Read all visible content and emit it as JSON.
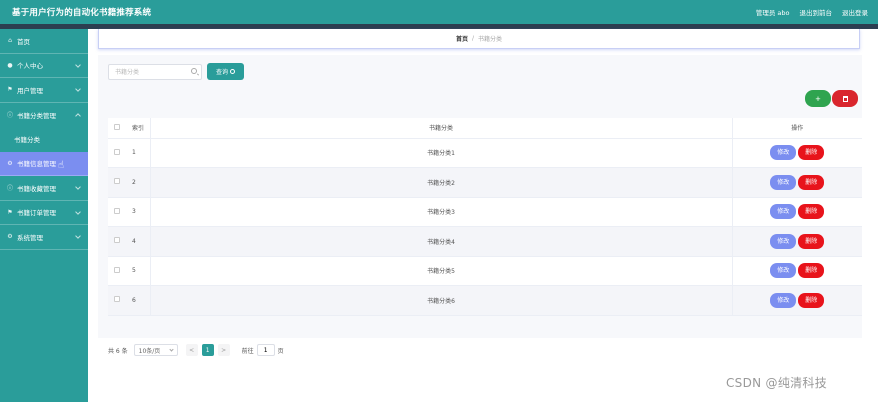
{
  "header": {
    "title": "基于用户行为的自动化书籍推荐系统",
    "welcome": "管理员 abo",
    "exit_backend": "退出到前台",
    "logout": "退出登录"
  },
  "sidebar": {
    "items": [
      {
        "label": "首页",
        "icon": "home-icon"
      },
      {
        "label": "个人中心",
        "icon": "user-icon"
      },
      {
        "label": "用户管理",
        "icon": "flag-icon"
      },
      {
        "label": "书籍分类管理",
        "icon": "info-icon"
      },
      {
        "label": "书籍分类",
        "icon": ""
      },
      {
        "label": "书籍信息管理",
        "icon": "gear-icon"
      },
      {
        "label": "书籍收藏管理",
        "icon": "info-icon"
      },
      {
        "label": "书籍订单管理",
        "icon": "flag-icon"
      },
      {
        "label": "系统管理",
        "icon": "gear-icon"
      }
    ]
  },
  "breadcrumb": {
    "home": "首页",
    "separator": "/",
    "current": "书籍分类"
  },
  "search": {
    "placeholder": "书籍分类",
    "value": "",
    "button_label": "查询"
  },
  "actions": {
    "add_symbol": "+"
  },
  "table": {
    "headers": {
      "index": "索引",
      "name": "书籍分类",
      "operation": "操作"
    },
    "rows": [
      {
        "index": "1",
        "name": "书籍分类1"
      },
      {
        "index": "2",
        "name": "书籍分类2"
      },
      {
        "index": "3",
        "name": "书籍分类3"
      },
      {
        "index": "4",
        "name": "书籍分类4"
      },
      {
        "index": "5",
        "name": "书籍分类5"
      },
      {
        "index": "6",
        "name": "书籍分类6"
      }
    ],
    "edit_label": "修改",
    "delete_label": "删除"
  },
  "pagination": {
    "total": "共 6 条",
    "page_size": "10条/页",
    "prev": "<",
    "current_page": "1",
    "next": ">",
    "goto_label": "前往",
    "goto_value": "1",
    "page_suffix": "页"
  },
  "watermark": "CSDN @纯清科技",
  "colors": {
    "primary": "#2a9d9a",
    "active_menu": "#7b8ef0",
    "add": "#2fa44f",
    "delete": "#d9262d"
  }
}
